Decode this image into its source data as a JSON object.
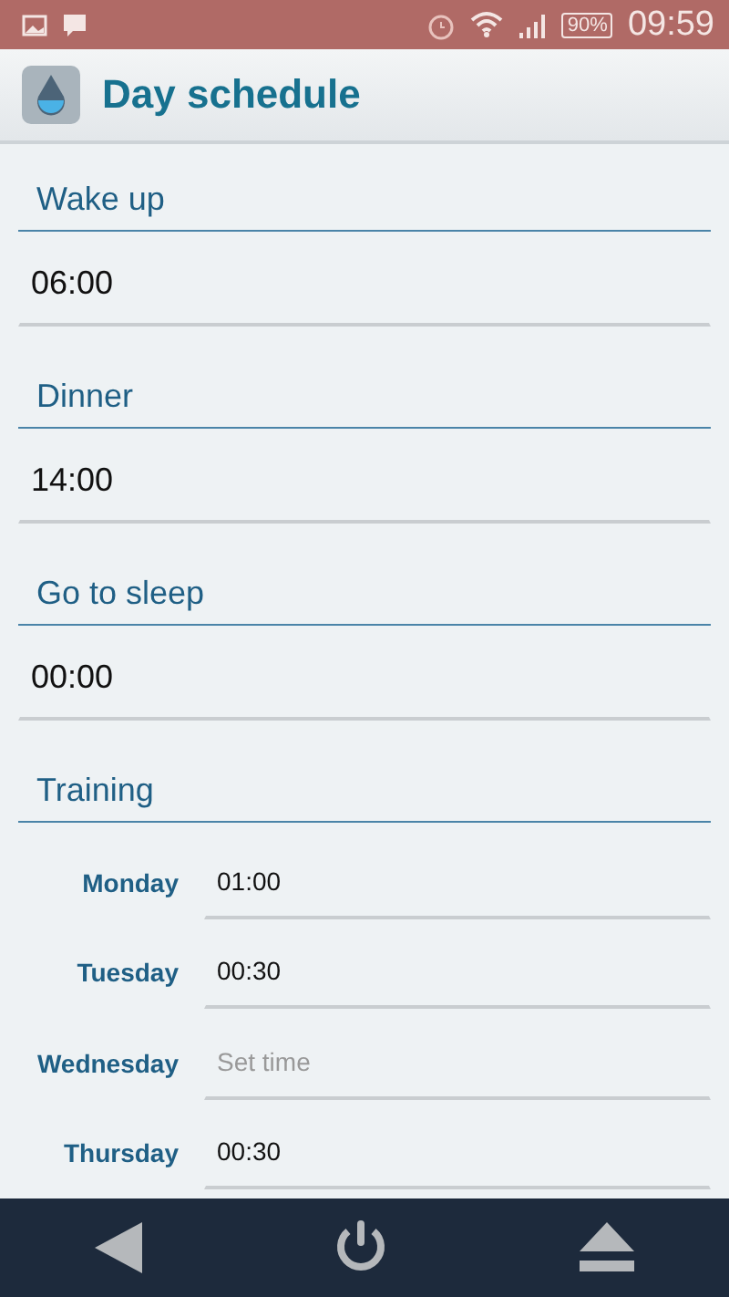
{
  "status_bar": {
    "battery": "90%",
    "time": "09:59"
  },
  "app_bar": {
    "title": "Day schedule"
  },
  "sections": [
    {
      "title": "Wake up",
      "value": "06:00"
    },
    {
      "title": "Dinner",
      "value": "14:00"
    },
    {
      "title": "Go to sleep",
      "value": "00:00"
    }
  ],
  "training": {
    "title": "Training",
    "days": [
      {
        "day": "Monday",
        "value": "01:00"
      },
      {
        "day": "Tuesday",
        "value": "00:30"
      },
      {
        "day": "Wednesday",
        "placeholder": "Set time"
      },
      {
        "day": "Thursday",
        "value": "00:30"
      }
    ]
  }
}
